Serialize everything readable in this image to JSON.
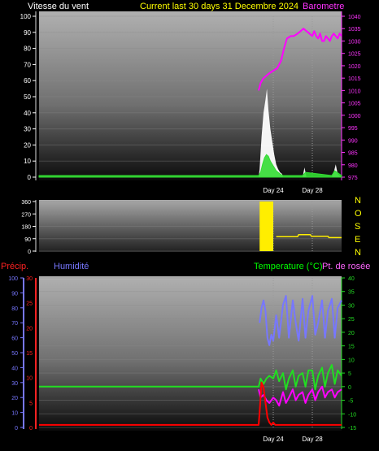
{
  "header": {
    "left_label": "Vitesse du vent",
    "center_label": "Current last 30 days 31 Decembre 2024",
    "right_label": "Barometre"
  },
  "direction_letters": [
    "N",
    "O",
    "S",
    "E",
    "N"
  ],
  "bottom_header": {
    "precip_label": "Précip.",
    "humidity_label": "Humidité",
    "temp_label": "Temperature (°C)",
    "dew_label": "Pt. de rosée"
  },
  "x_axis": {
    "ticks": [
      {
        "day": 24,
        "label": "Day 24"
      },
      {
        "day": 28,
        "label": "Day 28"
      }
    ]
  },
  "colors": {
    "wind_gust": "#ffffff",
    "wind_avg": "#33dd33",
    "pressure": "#ff00ff",
    "direction": "#ffee00",
    "precip": "#ff0000",
    "humidity": "#7777ff",
    "temperature": "#22dd22",
    "dewpoint": "#ff00ff",
    "center_label": "#ffff00",
    "temp_label": "#00ff00",
    "dew_label": "#ff66ff"
  },
  "chart_data": [
    {
      "type": "line",
      "title": "Current last 30 days 31 Decembre 2024",
      "xlim": [
        0,
        31
      ],
      "left_axis": {
        "label": "Vitesse du vent",
        "ylim": [
          0,
          100
        ],
        "ticks": [
          0,
          10,
          20,
          30,
          40,
          50,
          60,
          70,
          80,
          90,
          100
        ]
      },
      "right_axis": {
        "label": "Barometre",
        "ylim": [
          975,
          1040
        ],
        "ticks": [
          975,
          980,
          985,
          990,
          995,
          1000,
          1005,
          1010,
          1015,
          1020,
          1025,
          1030,
          1035,
          1040
        ]
      },
      "series": [
        {
          "name": "wind gust",
          "axis": "left",
          "x": [
            0,
            22.5,
            22.6,
            22.8,
            23.0,
            23.2,
            23.35,
            23.5,
            23.7,
            23.9,
            24.1,
            24.3,
            24.5,
            24.7,
            24.9,
            25.0,
            27.0,
            27.2,
            27.4,
            30.0,
            30.2,
            30.4,
            30.6,
            31.0
          ],
          "y": [
            0,
            0,
            5,
            25,
            40,
            48,
            55,
            42,
            30,
            22,
            14,
            8,
            5,
            3,
            2,
            0,
            0,
            6,
            0,
            0,
            3,
            8,
            2,
            0
          ]
        },
        {
          "name": "wind average",
          "axis": "left",
          "x": [
            0,
            22.5,
            22.7,
            22.9,
            23.1,
            23.3,
            23.5,
            23.7,
            23.9,
            24.1,
            24.3,
            24.5,
            24.7,
            25.0,
            27.0,
            27.3,
            30.0,
            30.3,
            31.0
          ],
          "y": [
            1,
            1,
            3,
            8,
            12,
            14,
            13,
            10,
            8,
            6,
            4,
            3,
            2,
            1,
            1,
            3,
            1,
            4,
            1
          ]
        },
        {
          "name": "pressure",
          "axis": "right",
          "x": [
            22.5,
            22.7,
            23.0,
            23.3,
            23.6,
            24.0,
            24.4,
            24.8,
            25.1,
            25.4,
            25.8,
            26.1,
            26.5,
            26.8,
            27.1,
            27.4,
            27.7,
            28.0,
            28.2,
            28.4,
            28.6,
            28.8,
            29.0,
            29.2,
            29.4,
            29.6,
            29.8,
            30.0,
            30.2,
            30.4,
            30.6,
            30.8,
            31.0
          ],
          "y": [
            1010,
            1013,
            1015,
            1016,
            1017,
            1018,
            1019,
            1022,
            1027,
            1031,
            1032,
            1032,
            1033,
            1034,
            1035,
            1034,
            1033,
            1032,
            1034,
            1032,
            1031,
            1033,
            1030,
            1030,
            1032,
            1031,
            1030,
            1032,
            1033,
            1032,
            1031,
            1033,
            1032
          ]
        }
      ]
    },
    {
      "type": "line",
      "ylim": [
        0,
        360
      ],
      "ticks": [
        0,
        90,
        180,
        270,
        360
      ],
      "xlim": [
        0,
        31
      ],
      "series": [
        {
          "name": "wind direction",
          "x": [
            22.6,
            24.0,
            24.3,
            26.5,
            26.6,
            27.8,
            27.9,
            29.6,
            29.7,
            31.0
          ],
          "y": [
            null,
            null,
            105,
            105,
            120,
            120,
            108,
            108,
            98,
            98
          ]
        },
        {
          "name": "wind direction band",
          "x_range": [
            22.6,
            24.0
          ],
          "y_range": [
            0,
            360
          ]
        }
      ]
    },
    {
      "type": "line",
      "xlim": [
        0,
        31
      ],
      "precip_axis": {
        "label": "Précip.",
        "ylim": [
          0,
          30
        ],
        "ticks": [
          0,
          5,
          10,
          15,
          20,
          25,
          30
        ]
      },
      "humidity_axis": {
        "label": "Humidité",
        "ylim": [
          0,
          100
        ],
        "ticks": [
          0,
          10,
          20,
          30,
          40,
          50,
          60,
          70,
          80,
          90,
          100
        ]
      },
      "temp_axis": {
        "label": "Temperature (°C)",
        "ylim": [
          -15,
          40
        ],
        "ticks": [
          -15,
          -10,
          -5,
          0,
          5,
          10,
          15,
          20,
          25,
          30,
          35,
          40
        ]
      },
      "series": [
        {
          "name": "precipitation",
          "axis": "precip",
          "x": [
            0,
            22.5,
            22.6,
            22.8,
            23.0,
            23.2,
            23.4,
            23.6,
            23.8,
            24.0,
            24.2,
            31.0
          ],
          "y": [
            0.5,
            0.5,
            3,
            9,
            8,
            5,
            2,
            1,
            0.5,
            1,
            0.5,
            0.5
          ]
        },
        {
          "name": "humidity",
          "axis": "humidity",
          "x": [
            22.6,
            22.8,
            23.0,
            23.2,
            23.4,
            23.6,
            23.8,
            24.0,
            24.3,
            24.6,
            25.0,
            25.3,
            25.6,
            26.0,
            26.3,
            26.6,
            27.0,
            27.3,
            27.6,
            28.0,
            28.3,
            28.6,
            29.0,
            29.3,
            29.6,
            30.0,
            30.3,
            30.6,
            31.0
          ],
          "y": [
            70,
            80,
            85,
            78,
            60,
            55,
            62,
            58,
            75,
            60,
            82,
            88,
            60,
            85,
            70,
            58,
            86,
            60,
            78,
            88,
            62,
            70,
            85,
            60,
            78,
            86,
            60,
            80,
            85
          ]
        },
        {
          "name": "temperature",
          "axis": "temp",
          "x": [
            0,
            22.5,
            22.7,
            23.0,
            23.3,
            23.6,
            24.0,
            24.3,
            24.6,
            25.0,
            25.3,
            25.6,
            26.0,
            26.3,
            26.6,
            27.0,
            27.3,
            27.6,
            28.0,
            28.3,
            28.6,
            29.0,
            29.3,
            29.6,
            30.0,
            30.3,
            30.6,
            31.0
          ],
          "y": [
            0,
            0,
            3,
            1,
            3,
            4,
            3,
            6,
            2,
            5,
            -1,
            3,
            6,
            0,
            4,
            5,
            0,
            6,
            6,
            -1,
            4,
            7,
            0,
            5,
            8,
            1,
            6,
            4
          ]
        },
        {
          "name": "dew point",
          "axis": "temp",
          "x": [
            22.5,
            22.7,
            23.0,
            23.3,
            23.6,
            24.0,
            24.3,
            24.6,
            25.0,
            25.3,
            25.6,
            26.0,
            26.3,
            26.6,
            27.0,
            27.3,
            27.6,
            28.0,
            28.3,
            28.6,
            29.0,
            29.3,
            29.6,
            30.0,
            30.3,
            30.6,
            31.0
          ],
          "y": [
            -1,
            -4,
            -3,
            -5,
            -6,
            -4,
            -5,
            -7,
            -2,
            -6,
            -4,
            -1,
            -5,
            -3,
            -2,
            -6,
            -3,
            -1,
            -5,
            -2,
            0,
            -4,
            -2,
            -1,
            -4,
            -2,
            -1
          ]
        }
      ]
    }
  ]
}
